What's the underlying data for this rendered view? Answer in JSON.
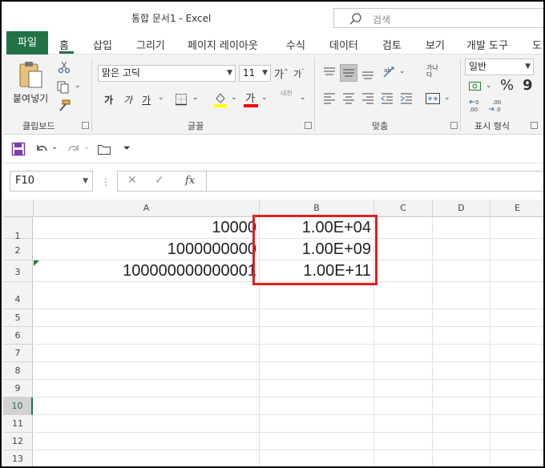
{
  "window": {
    "title": "통합 문서1  -  Excel"
  },
  "search": {
    "label": "검색"
  },
  "ribbon_tabs": [
    "파일",
    "홈",
    "삽입",
    "그리기",
    "페이지 레이아웃",
    "수식",
    "데이터",
    "검토",
    "보기",
    "개발 도구",
    "도"
  ],
  "clipboard": {
    "paste_label": "붙여넣기",
    "group_label": "클립보드"
  },
  "font": {
    "name": "맑은 고딕",
    "size": "11",
    "increase": "가",
    "decrease": "가",
    "bold": "가",
    "italic": "가",
    "underline": "가",
    "font_color_glyph": "가",
    "phonetic": "내천",
    "group_label": "글꼴"
  },
  "alignment": {
    "group_label": "맞춤",
    "wrap_label": "가나다"
  },
  "number": {
    "format": "일반",
    "group_label": "표시 형식",
    "percent": "%",
    "comma": "9"
  },
  "colors": {
    "accent": "#217346",
    "highlight_border": "#e41e1e",
    "font_color": "#ff0000",
    "fill_color": "#ffff00"
  },
  "formula_bar": {
    "name_box": "F10",
    "cancel": "✕",
    "enter": "✓",
    "fx": "fx"
  },
  "columns": [
    "A",
    "B",
    "C",
    "D",
    "E"
  ],
  "rows": [
    "1",
    "2",
    "3",
    "4",
    "5",
    "6",
    "7",
    "8",
    "9",
    "10",
    "11",
    "12",
    "13"
  ],
  "selected_row": "10",
  "cells": {
    "A1": "10000",
    "A2": "1000000000",
    "A3": "100000000000001",
    "B1": "1.00E+04",
    "B2": "1.00E+09",
    "B3": "1.00E+11"
  }
}
